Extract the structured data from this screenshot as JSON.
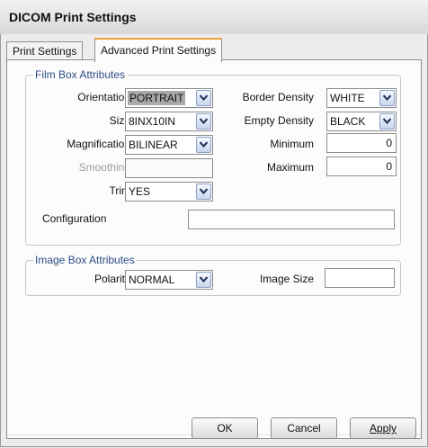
{
  "window": {
    "title": "DICOM Print Settings"
  },
  "tabs": [
    {
      "label": "Print Settings"
    },
    {
      "label": "Advanced Print Settings"
    }
  ],
  "film_box": {
    "legend": "Film Box Attributes",
    "orientation": {
      "label": "Orientation",
      "value": "PORTRAIT"
    },
    "size": {
      "label": "Size",
      "value": "8INX10IN"
    },
    "magnification": {
      "label": "Magnification",
      "value": "BILINEAR"
    },
    "smoothing": {
      "label": "Smoothing",
      "value": ""
    },
    "trim": {
      "label": "Trim",
      "value": "YES"
    },
    "border_density": {
      "label": "Border Density",
      "value": "WHITE"
    },
    "empty_density": {
      "label": "Empty Density",
      "value": "BLACK"
    },
    "minimum": {
      "label": "Minimum",
      "value": "0"
    },
    "maximum": {
      "label": "Maximum",
      "value": "0"
    },
    "configuration": {
      "label": "Configuration",
      "value": ""
    }
  },
  "image_box": {
    "legend": "Image Box Attributes",
    "polarity": {
      "label": "Polarity",
      "value": "NORMAL"
    },
    "image_size": {
      "label": "Image Size",
      "value": ""
    }
  },
  "buttons": {
    "ok": "OK",
    "cancel": "Cancel",
    "apply": "Apply"
  },
  "icons": {
    "dropdown": "chevron-down-icon"
  },
  "colors": {
    "tab_accent": "#e8a33a",
    "legend_text": "#2d4d86",
    "combo_arrow": "#c9d6ee"
  }
}
